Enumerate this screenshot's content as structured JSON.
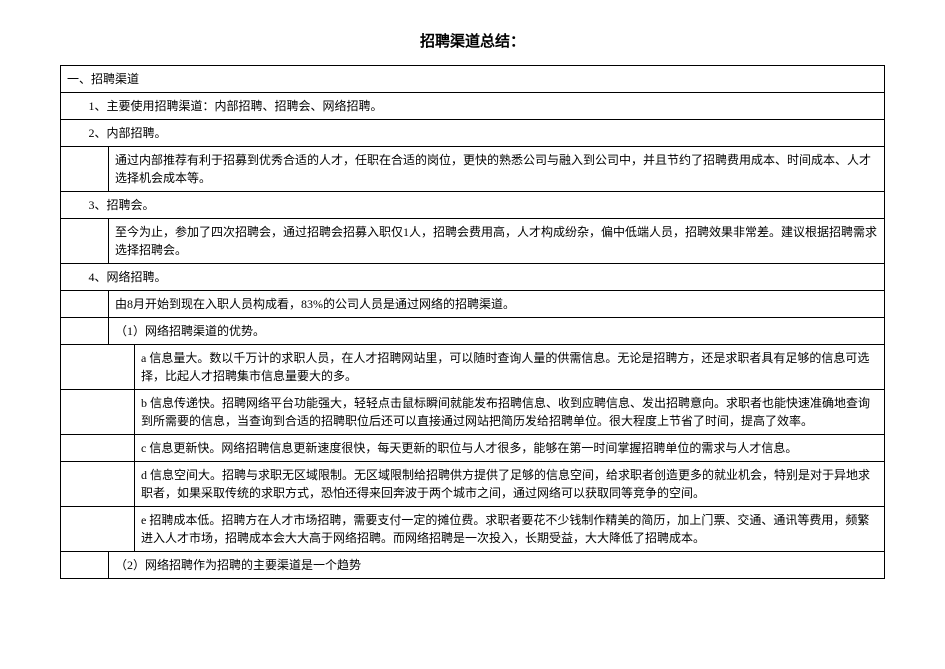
{
  "title": "招聘渠道总结：",
  "rows": {
    "section": "一、招聘渠道",
    "r1": "1、主要使用招聘渠道：内部招聘、招聘会、网络招聘。",
    "r2": "2、内部招聘。",
    "r2a": "通过内部推荐有利于招募到优秀合适的人才，任职在合适的岗位，更快的熟悉公司与融入到公司中，并且节约了招聘费用成本、时间成本、人才选择机会成本等。",
    "r3": "3、招聘会。",
    "r3a": "至今为止，参加了四次招聘会，通过招聘会招募入职仅1人，招聘会费用高，人才构成纷杂，偏中低端人员，招聘效果非常差。建议根据招聘需求选择招聘会。",
    "r4": "4、网络招聘。",
    "r4a": "由8月开始到现在入职人员构成看，83%的公司人员是通过网络的招聘渠道。",
    "r4b": "（1）网络招聘渠道的优势。",
    "r4b_a": "a 信息量大。数以千万计的求职人员，在人才招聘网站里，可以随时查询人量的供需信息。无论是招聘方，还是求职者具有足够的信息可选择，比起人才招聘集市信息量要大的多。",
    "r4b_b": "b 信息传递快。招聘网络平台功能强大，轻轻点击鼠标瞬间就能发布招聘信息、收到应聘信息、发出招聘意向。求职者也能快速准确地查询到所需要的信息，当查询到合适的招聘职位后还可以直接通过网站把简历发给招聘单位。很大程度上节省了时间，提高了效率。",
    "r4b_c": "c 信息更新快。网络招聘信息更新速度很快，每天更新的职位与人才很多，能够在第一时间掌握招聘单位的需求与人才信息。",
    "r4b_d": "d 信息空间大。招聘与求职无区域限制。无区域限制给招聘供方提供了足够的信息空间，给求职者创造更多的就业机会，特别是对于异地求职者，如果采取传统的求职方式，恐怕还得来回奔波于两个城市之间，通过网络可以获取同等竞争的空间。",
    "r4b_e": "e 招聘成本低。招聘方在人才市场招聘，需要支付一定的摊位费。求职者要花不少钱制作精美的简历，加上门票、交通、通讯等费用，频繁进入人才市场，招聘成本会大大高于网络招聘。而网络招聘是一次投入，长期受益，大大降低了招聘成本。",
    "r4c": "（2）网络招聘作为招聘的主要渠道是一个趋势"
  }
}
